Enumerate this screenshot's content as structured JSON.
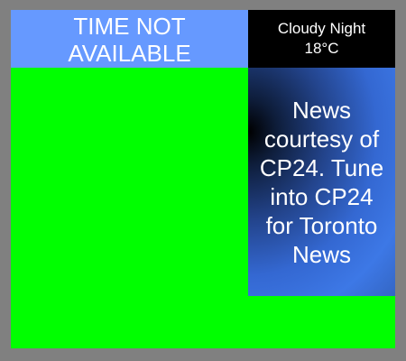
{
  "time_panel": {
    "line1": "TIME NOT",
    "line2": "AVAILABLE",
    "color": "#6699ff"
  },
  "weather": {
    "condition": "Cloudy Night",
    "temperature": "18°C"
  },
  "news": {
    "text": "News courtesy of CP24. Tune into CP24 for Toronto News"
  },
  "colors": {
    "background": "#808080",
    "video_area": "#00ff00",
    "weather_bg": "#000000",
    "text": "#ffffff"
  }
}
